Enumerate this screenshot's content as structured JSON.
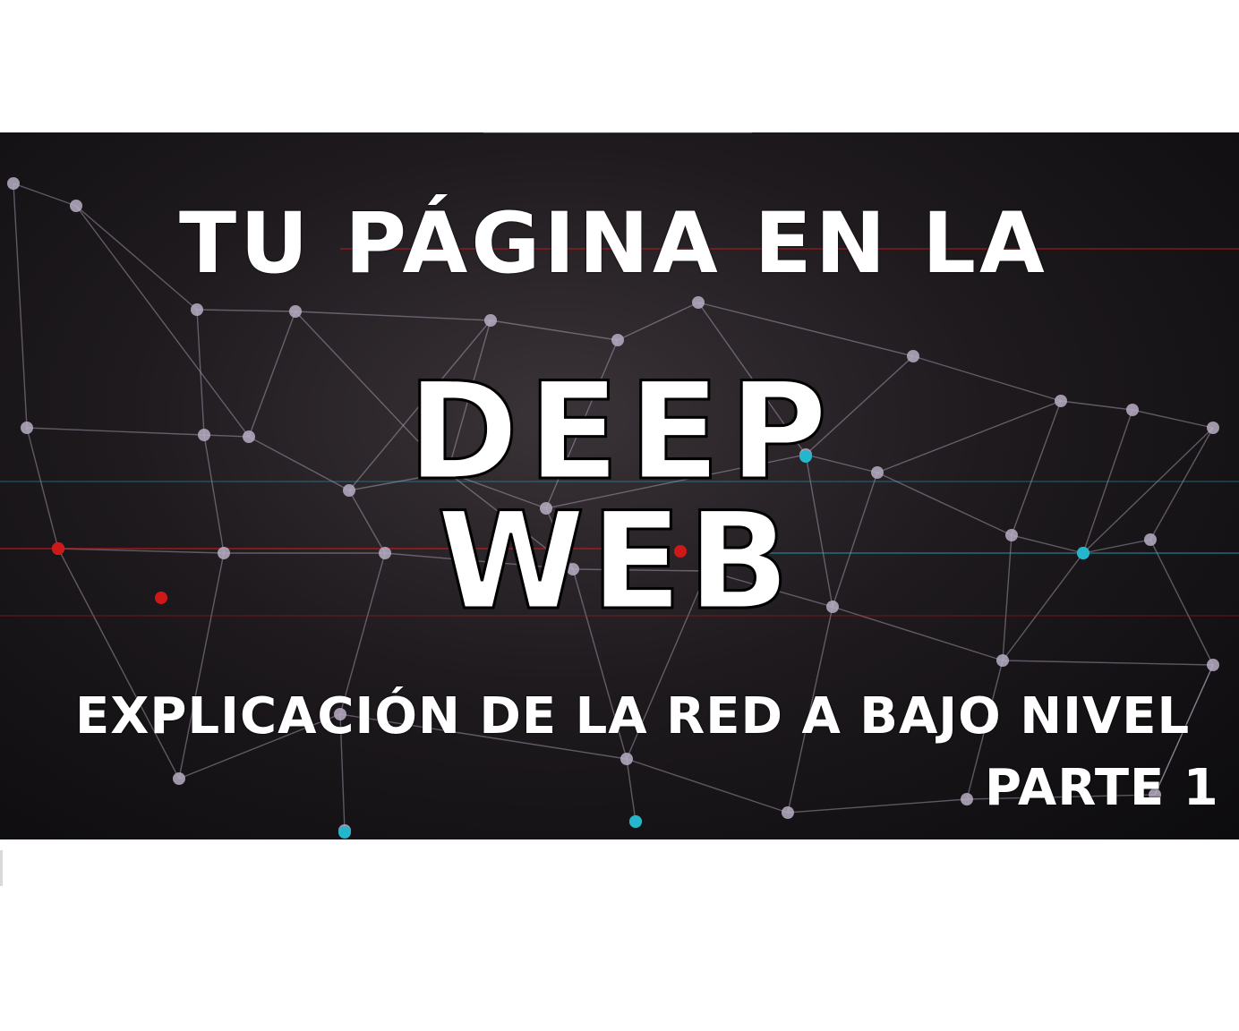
{
  "banner": {
    "title_line": "TU PÁGINA EN LA",
    "deep": "DEEP",
    "web": "WEB",
    "subtitle": "EXPLICACIÓN DE LA RED A BAJO NIVEL",
    "part": "PARTE 1"
  },
  "colors": {
    "background": "#141214",
    "text": "#ffffff",
    "node": "#b9aec4",
    "accent_red": "#d01818",
    "accent_cyan": "#23b6cc"
  }
}
